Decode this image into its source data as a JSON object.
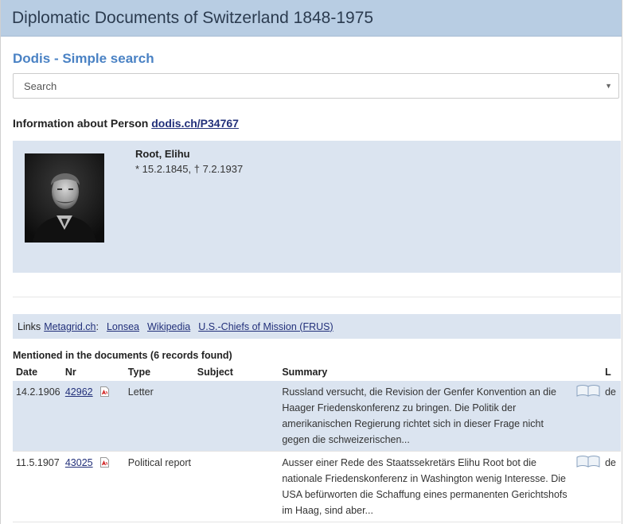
{
  "header": {
    "title": "Diplomatic Documents of Switzerland 1848-1975"
  },
  "search_section": {
    "title": "Dodis - Simple search",
    "search_value": "Search"
  },
  "person": {
    "heading_prefix": "Information about Person",
    "heading_link": "dodis.ch/P34767",
    "name": "Root, Elihu",
    "dates": "* 15.2.1845, † 7.2.1937"
  },
  "links": {
    "label": "Links",
    "metagrid": "Metagrid.ch",
    "colon": ":",
    "items": [
      "Lonsea",
      "Wikipedia",
      "U.S.-Chiefs of Mission (FRUS)"
    ]
  },
  "documents": {
    "heading": "Mentioned in the documents (6 records found)",
    "columns": [
      "Date",
      "Nr",
      "Type",
      "Subject",
      "Summary",
      "",
      "L"
    ],
    "rows": [
      {
        "date": "14.2.1906",
        "nr": "42962",
        "type": "Letter",
        "subject": "",
        "summary": "Russland versucht, die Revision der Genfer Konvention an die Haager Friedenskonferenz zu bringen. Die Politik der amerikanischen Regierung richtet sich in dieser Frage nicht gegen die schweizerischen...",
        "lang": "de"
      },
      {
        "date": "11.5.1907",
        "nr": "43025",
        "type": "Political report",
        "subject": "",
        "summary": "Ausser einer Rede des Staatssekretärs Elihu Root bot die nationale Friedenskonferenz in Washington wenig Interesse. Die USA befürworten die Schaffung eines permanenten Gerichtshofs im Haag, sind aber...",
        "lang": "de"
      }
    ]
  },
  "icons": {
    "pdf": "pdf-icon",
    "book": "book-icon",
    "dropdown": "caret-down-icon"
  },
  "colors": {
    "header_bg": "#b8cde3",
    "panel_bg": "#dbe4f0",
    "accent_title": "#4a82c4",
    "link": "#22307a"
  }
}
